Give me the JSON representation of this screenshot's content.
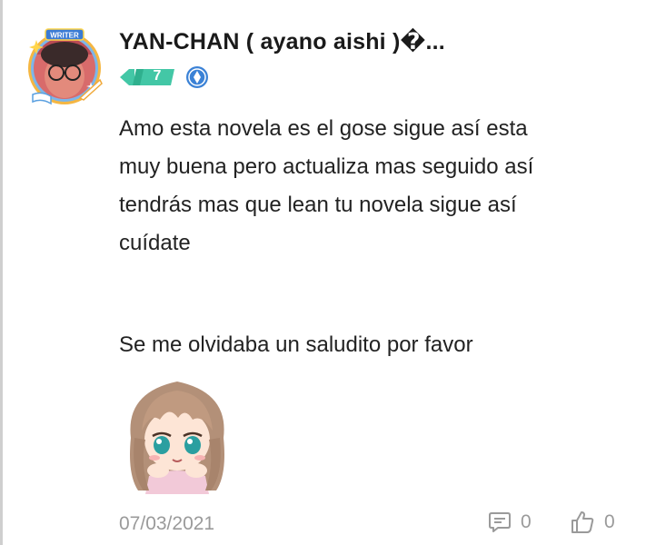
{
  "post": {
    "author": "YAN-CHAN ( ayano aishi )�...",
    "level": "7",
    "avatar_frame_label": "WRITER",
    "comment_lines": [
      "Amo esta novela es el gose sigue así esta",
      "muy buena pero actualiza mas seguido así",
      "tendrás mas que lean tu novela sigue así",
      "cuídate"
    ],
    "extra_line": "Se me olvidaba un saludito por favor",
    "date": "07/03/2021",
    "reply_count": "0",
    "like_count": "0"
  },
  "icons": {
    "verified": "verified-badge-icon",
    "reply": "comment-icon",
    "like": "thumbs-up-icon",
    "sticker": "anime-girl-sticker"
  },
  "colors": {
    "level_badge": "#43c7a6",
    "verified": "#3b82d6",
    "muted": "#9a9a9a",
    "text": "#222222"
  }
}
